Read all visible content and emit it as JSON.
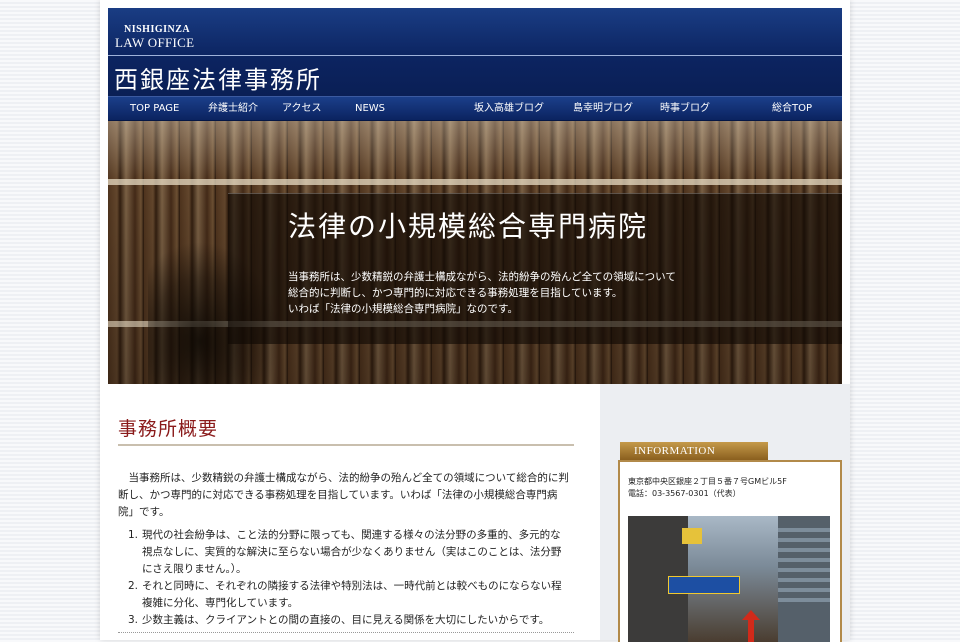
{
  "header": {
    "logo_en_line1": "NISHIGINZA",
    "logo_en_line2": "LAW OFFICE",
    "logo_jp": "西銀座法律事務所"
  },
  "nav": {
    "items": [
      "TOP PAGE",
      "弁護士紹介",
      "アクセス",
      "NEWS",
      "坂入高雄ブログ",
      "島幸明ブログ",
      "時事ブログ",
      "総合TOP"
    ]
  },
  "hero": {
    "title": "法律の小規模総合専門病院",
    "lines": [
      "当事務所は、少数精鋭の弁護士構成ながら、法的紛争の殆んど全ての領域について",
      "総合的に判断し、かつ専門的に対応できる事務処理を目指しています。",
      "いわば「法律の小規模総合専門病院」なのです。"
    ]
  },
  "main": {
    "section_title": "事務所概要",
    "paragraph_lines": [
      "　当事務所は、少数精鋭の弁護士構成ながら、法的紛争の殆んど全ての領域について総合的に判",
      "断し、かつ専門的に対応できる事務処理を目指しています。いわば「法律の小規模総合専門病",
      "院」です。"
    ],
    "list": [
      {
        "num": "1.",
        "lines": [
          "現代の社会紛争は、こと法的分野に限っても、関連する様々の法分野の多重的、多元的な",
          "視点なしに、実質的な解決に至らない場合が少なくありません（実はこのことは、法分野",
          "にさえ限りません。）。"
        ]
      },
      {
        "num": "2.",
        "lines": [
          "それと同時に、それぞれの隣接する法律や特別法は、一時代前とは較べものにならない程",
          "複雑に分化、専門化しています。"
        ]
      },
      {
        "num": "3.",
        "lines": [
          "少数主義は、クライアントとの間の直接の、目に見える関係を大切にしたいからです。"
        ]
      }
    ]
  },
  "sidebar": {
    "info_title": "INFORMATION",
    "address": "東京都中央区銀座２丁目５番７号GMビル5F",
    "phone": "電話：03-3567-0301（代表）"
  }
}
